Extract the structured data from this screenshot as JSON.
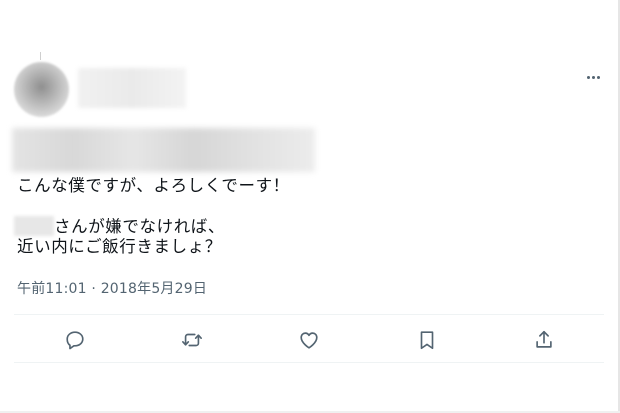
{
  "tweet": {
    "line1": "こんな僕ですが、よろしくでーす！",
    "line2": "さんが嫌でなければ、",
    "line3": "近い内にご飯行きましょ？",
    "timestamp": "午前11:01 · 2018年5月29日"
  },
  "icons": {
    "more": "more-icon",
    "reply": "reply-icon",
    "retweet": "retweet-icon",
    "like": "heart-icon",
    "bookmark": "bookmark-icon",
    "share": "share-icon"
  },
  "colors": {
    "text": "#0f1419",
    "secondary": "#536471",
    "divider": "#eff3f4"
  }
}
